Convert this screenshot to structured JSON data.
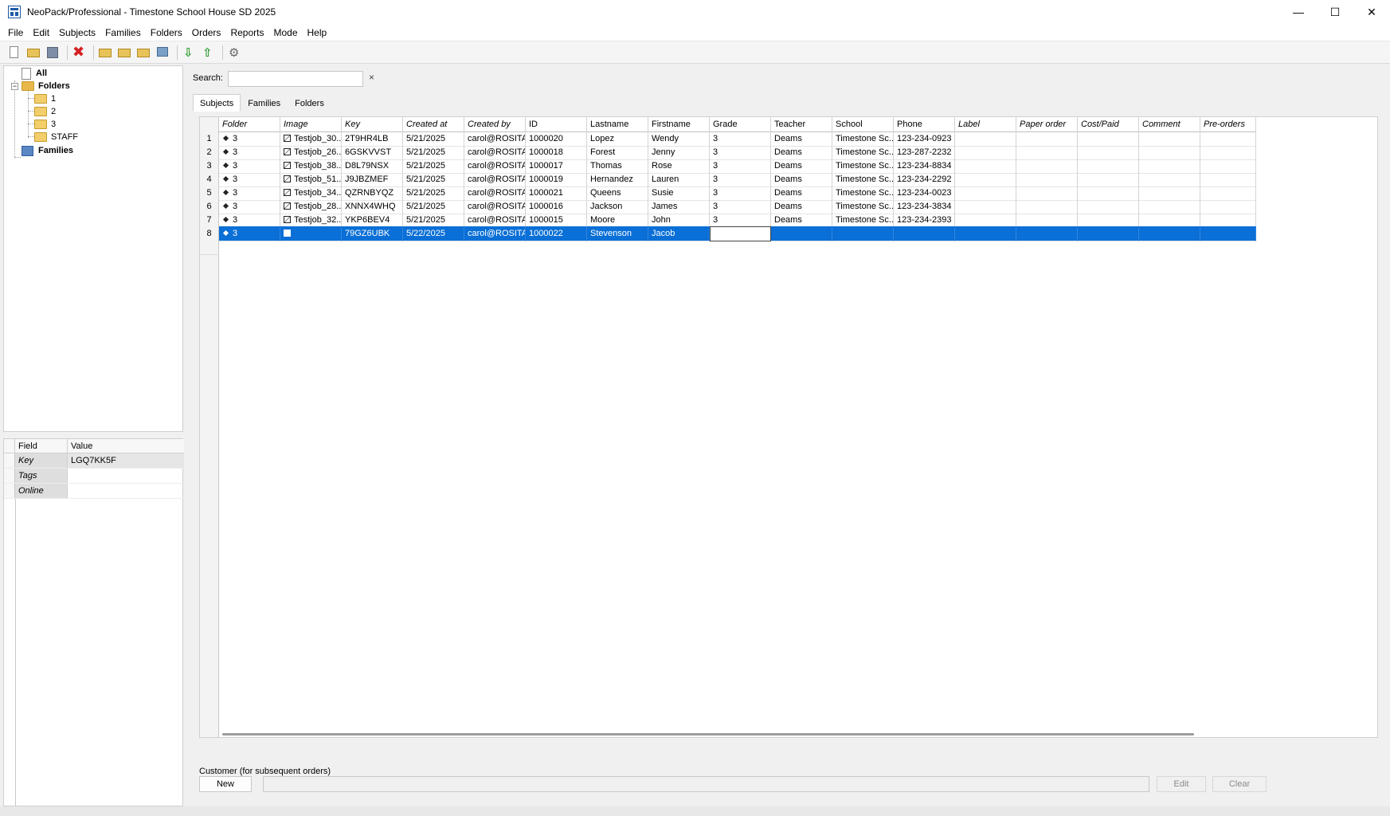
{
  "window": {
    "title": "NeoPack/Professional - Timestone School House SD 2025"
  },
  "menu": [
    "File",
    "Edit",
    "Subjects",
    "Families",
    "Folders",
    "Orders",
    "Reports",
    "Mode",
    "Help"
  ],
  "tree": {
    "all": "All",
    "folders": "Folders",
    "folder_items": [
      "1",
      "2",
      "3",
      "STAFF"
    ],
    "families": "Families"
  },
  "props": {
    "headers": {
      "field": "Field",
      "value": "Value"
    },
    "rows": [
      {
        "field": "Key",
        "value": "LGQ7KK5F"
      },
      {
        "field": "Tags",
        "value": ""
      },
      {
        "field": "Online",
        "value": ""
      }
    ]
  },
  "search": {
    "label": "Search:",
    "value": "",
    "clear": "×"
  },
  "tabs": [
    "Subjects",
    "Families",
    "Folders"
  ],
  "grid": {
    "columns": [
      "Folder",
      "Image",
      "Key",
      "Created at",
      "Created by",
      "ID",
      "Lastname",
      "Firstname",
      "Grade",
      "Teacher",
      "School",
      "Phone",
      "Label",
      "Paper order",
      "Cost/Paid",
      "Comment",
      "Pre-orders"
    ],
    "rows": [
      {
        "n": "1",
        "folder": "3",
        "image": "Testjob_30...",
        "key": "2T9HR4LB",
        "created_at": "5/21/2025",
        "created_by": "carol@ROSITA",
        "id": "1000020",
        "lastname": "Lopez",
        "firstname": "Wendy",
        "grade": "3",
        "teacher": "Deams",
        "school": "Timestone Sc...",
        "phone": "123-234-0923"
      },
      {
        "n": "2",
        "folder": "3",
        "image": "Testjob_26...",
        "key": "6GSKVVST",
        "created_at": "5/21/2025",
        "created_by": "carol@ROSITA",
        "id": "1000018",
        "lastname": "Forest",
        "firstname": "Jenny",
        "grade": "3",
        "teacher": "Deams",
        "school": "Timestone Sc...",
        "phone": "123-287-2232"
      },
      {
        "n": "3",
        "folder": "3",
        "image": "Testjob_38...",
        "key": "D8L79NSX",
        "created_at": "5/21/2025",
        "created_by": "carol@ROSITA",
        "id": "1000017",
        "lastname": "Thomas",
        "firstname": "Rose",
        "grade": "3",
        "teacher": "Deams",
        "school": "Timestone Sc...",
        "phone": "123-234-8834"
      },
      {
        "n": "4",
        "folder": "3",
        "image": "Testjob_51...",
        "key": "J9JBZMEF",
        "created_at": "5/21/2025",
        "created_by": "carol@ROSITA",
        "id": "1000019",
        "lastname": "Hernandez",
        "firstname": "Lauren",
        "grade": "3",
        "teacher": "Deams",
        "school": "Timestone Sc...",
        "phone": "123-234-2292"
      },
      {
        "n": "5",
        "folder": "3",
        "image": "Testjob_34...",
        "key": "QZRNBYQZ",
        "created_at": "5/21/2025",
        "created_by": "carol@ROSITA",
        "id": "1000021",
        "lastname": "Queens",
        "firstname": "Susie",
        "grade": "3",
        "teacher": "Deams",
        "school": "Timestone Sc...",
        "phone": "123-234-0023"
      },
      {
        "n": "6",
        "folder": "3",
        "image": "Testjob_28...",
        "key": "XNNX4WHQ",
        "created_at": "5/21/2025",
        "created_by": "carol@ROSITA",
        "id": "1000016",
        "lastname": "Jackson",
        "firstname": "James",
        "grade": "3",
        "teacher": "Deams",
        "school": "Timestone Sc...",
        "phone": "123-234-3834"
      },
      {
        "n": "7",
        "folder": "3",
        "image": "Testjob_32...",
        "key": "YKP6BEV4",
        "created_at": "5/21/2025",
        "created_by": "carol@ROSITA",
        "id": "1000015",
        "lastname": "Moore",
        "firstname": "John",
        "grade": "3",
        "teacher": "Deams",
        "school": "Timestone Sc...",
        "phone": "123-234-2393"
      },
      {
        "n": "8",
        "folder": "3",
        "image": "",
        "key": "79GZ6UBK",
        "created_at": "5/22/2025",
        "created_by": "carol@ROSITA",
        "id": "1000022",
        "lastname": "Stevenson",
        "firstname": "Jacob",
        "grade": "",
        "teacher": "",
        "school": "",
        "phone": ""
      }
    ]
  },
  "customer": {
    "label": "Customer (for subsequent orders)",
    "new": "New",
    "edit": "Edit",
    "clear": "Clear"
  },
  "colors": {
    "selection": "#0a6fd6"
  }
}
